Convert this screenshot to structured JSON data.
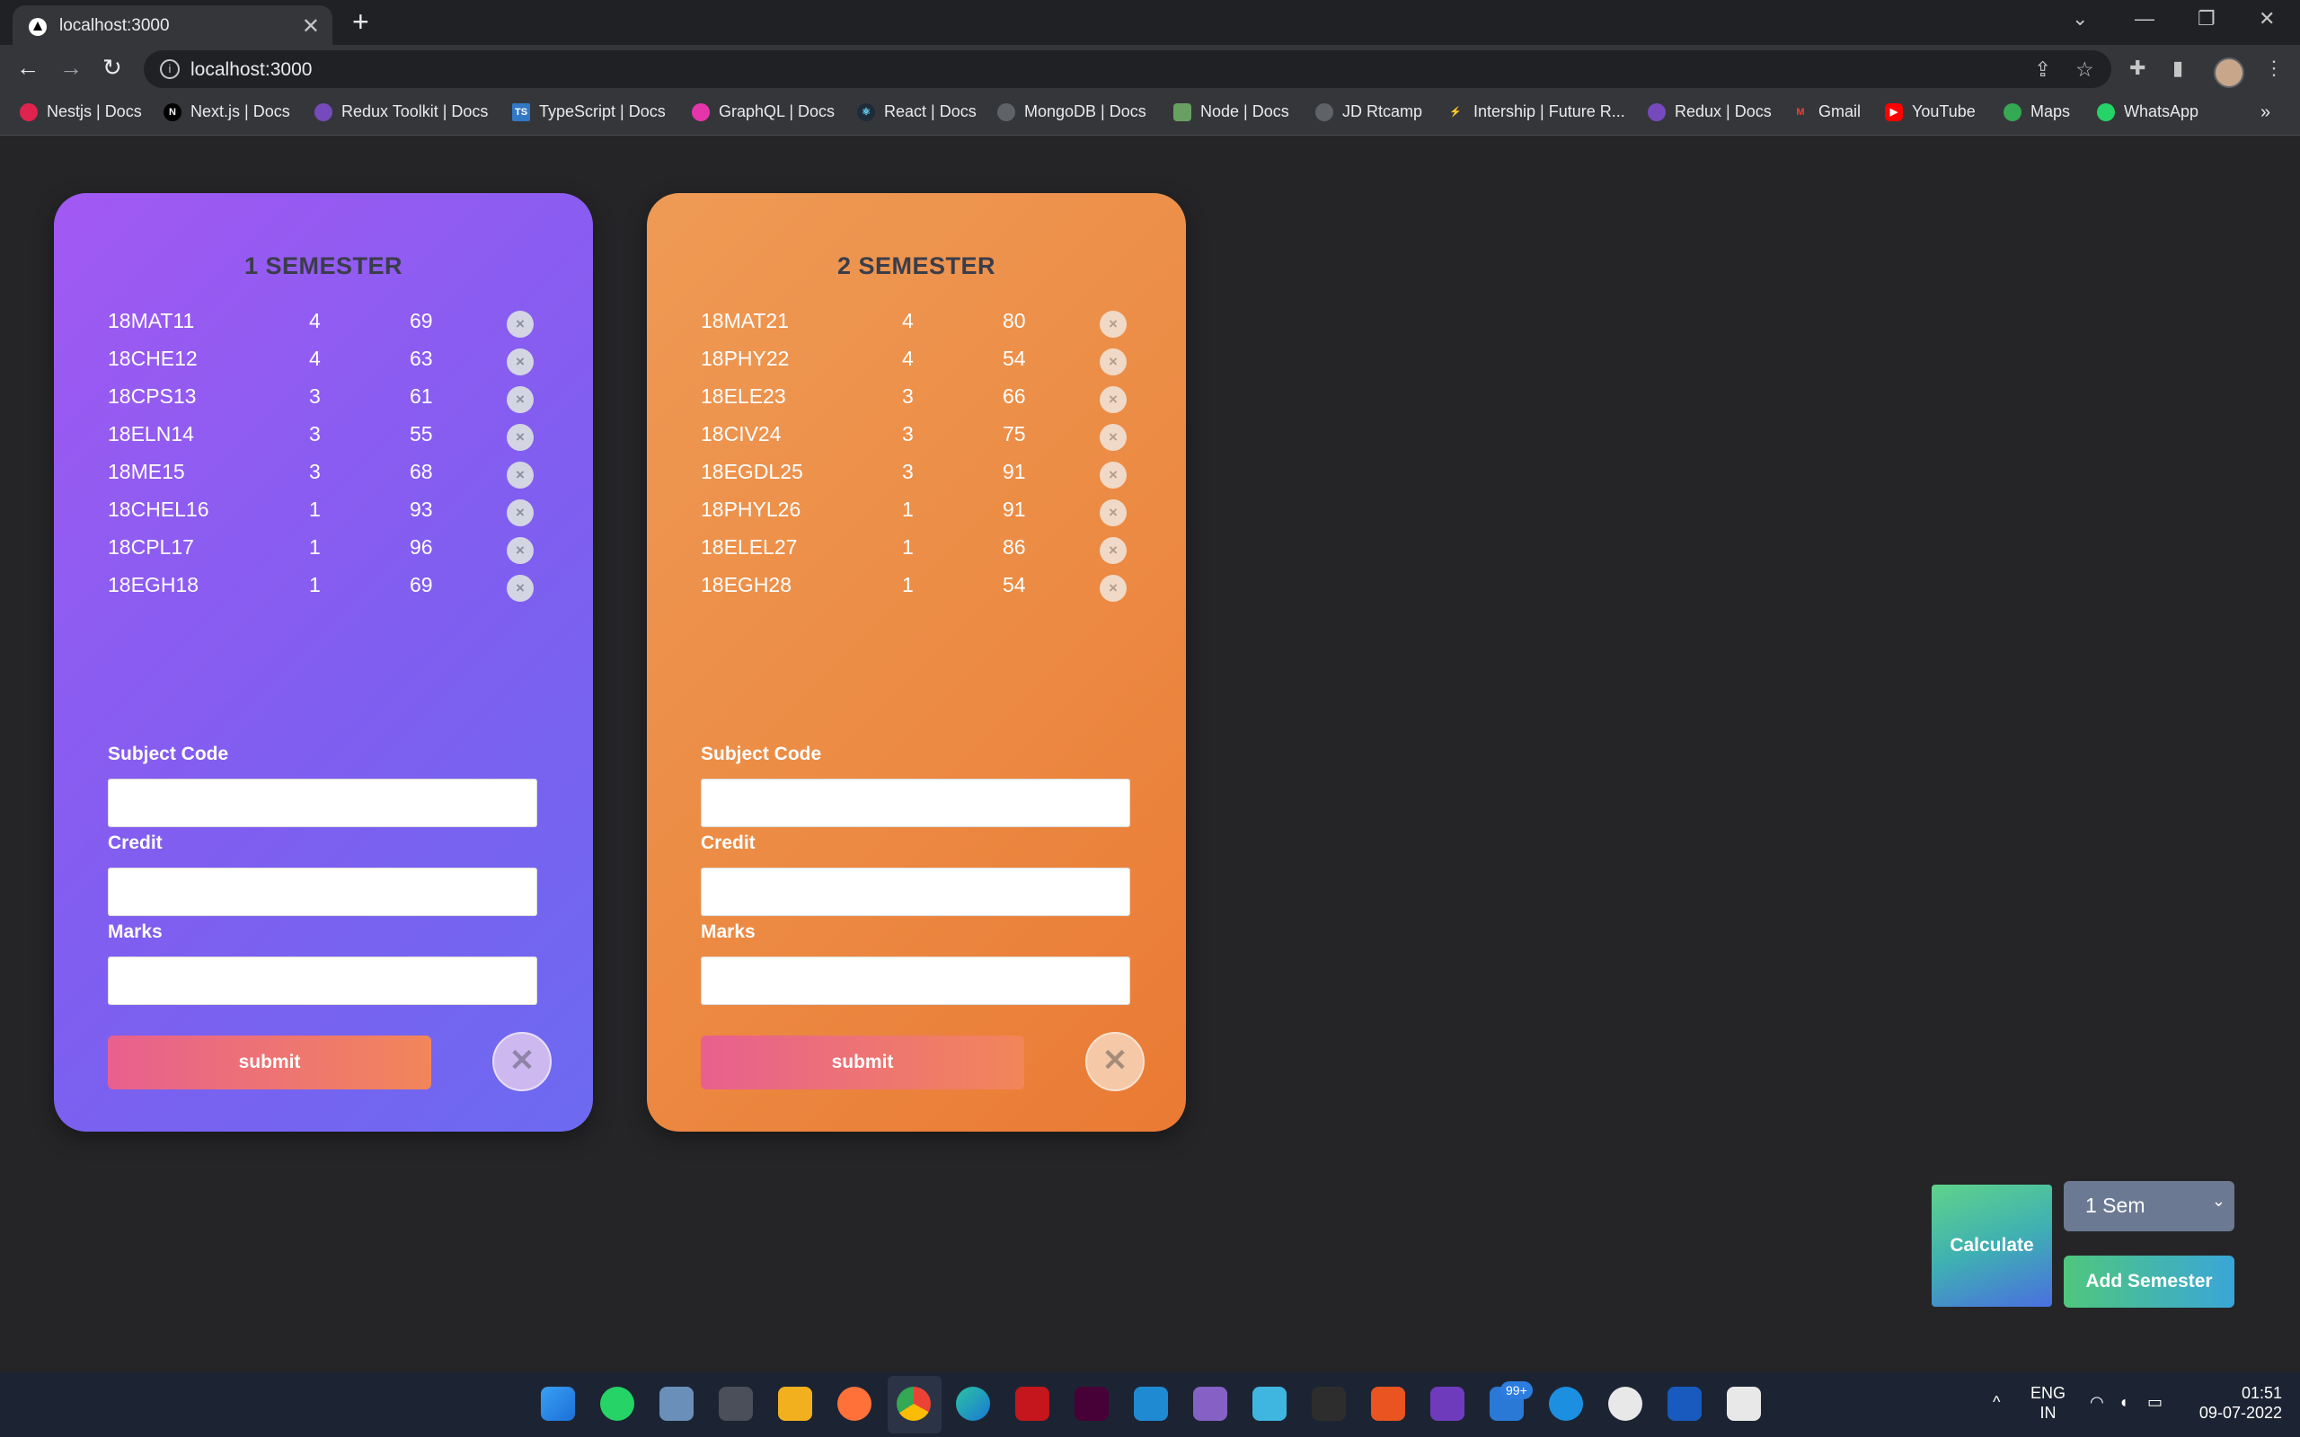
{
  "browser": {
    "tab_title": "localhost:3000",
    "url": "localhost:3000",
    "bookmarks": [
      {
        "label": "Nestjs | Docs",
        "icon": "nestjs-icon",
        "color": "#e0234e"
      },
      {
        "label": "Next.js | Docs",
        "icon": "nextjs-icon",
        "color": "#000000"
      },
      {
        "label": "Redux Toolkit | Docs",
        "icon": "redux-icon",
        "color": "#764abc"
      },
      {
        "label": "TypeScript | Docs",
        "icon": "typescript-icon",
        "color": "#3178c6"
      },
      {
        "label": "GraphQL | Docs",
        "icon": "graphql-icon",
        "color": "#e535ab"
      },
      {
        "label": "React | Docs",
        "icon": "react-icon",
        "color": "#61dafb"
      },
      {
        "label": "MongoDB | Docs",
        "icon": "globe-icon",
        "color": "#5f6368"
      },
      {
        "label": "Node | Docs",
        "icon": "node-icon",
        "color": "#68a063"
      },
      {
        "label": "JD Rtcamp",
        "icon": "globe-icon",
        "color": "#5f6368"
      },
      {
        "label": "Intership | Future R...",
        "icon": "bolt-icon",
        "color": "#f4c430"
      },
      {
        "label": "Redux | Docs",
        "icon": "redux-icon",
        "color": "#764abc"
      },
      {
        "label": "Gmail",
        "icon": "gmail-icon",
        "color": "#ea4335"
      },
      {
        "label": "YouTube",
        "icon": "youtube-icon",
        "color": "#ff0000"
      },
      {
        "label": "Maps",
        "icon": "maps-icon",
        "color": "#34a853"
      },
      {
        "label": "WhatsApp",
        "icon": "whatsapp-icon",
        "color": "#25d366"
      }
    ]
  },
  "semesters": [
    {
      "title": "1 SEMESTER",
      "theme": "purple",
      "subjects": [
        {
          "code": "18MAT11",
          "credit": "4",
          "marks": "69"
        },
        {
          "code": "18CHE12",
          "credit": "4",
          "marks": "63"
        },
        {
          "code": "18CPS13",
          "credit": "3",
          "marks": "61"
        },
        {
          "code": "18ELN14",
          "credit": "3",
          "marks": "55"
        },
        {
          "code": "18ME15",
          "credit": "3",
          "marks": "68"
        },
        {
          "code": "18CHEL16",
          "credit": "1",
          "marks": "93"
        },
        {
          "code": "18CPL17",
          "credit": "1",
          "marks": "96"
        },
        {
          "code": "18EGH18",
          "credit": "1",
          "marks": "69"
        }
      ]
    },
    {
      "title": "2 SEMESTER",
      "theme": "orange",
      "subjects": [
        {
          "code": "18MAT21",
          "credit": "4",
          "marks": "80"
        },
        {
          "code": "18PHY22",
          "credit": "4",
          "marks": "54"
        },
        {
          "code": "18ELE23",
          "credit": "3",
          "marks": "66"
        },
        {
          "code": "18CIV24",
          "credit": "3",
          "marks": "75"
        },
        {
          "code": "18EGDL25",
          "credit": "3",
          "marks": "91"
        },
        {
          "code": "18PHYL26",
          "credit": "1",
          "marks": "91"
        },
        {
          "code": "18ELEL27",
          "credit": "1",
          "marks": "86"
        },
        {
          "code": "18EGH28",
          "credit": "1",
          "marks": "54"
        }
      ]
    }
  ],
  "form": {
    "subject_code_label": "Subject Code",
    "credit_label": "Credit",
    "marks_label": "Marks",
    "submit_label": "submit"
  },
  "controls": {
    "calculate_label": "Calculate",
    "semester_select_value": "1 Sem",
    "add_semester_label": "Add Semester"
  },
  "taskbar": {
    "notification_badge": "99+",
    "language": "ENG",
    "region": "IN",
    "time": "01:51",
    "date": "09-07-2022"
  }
}
